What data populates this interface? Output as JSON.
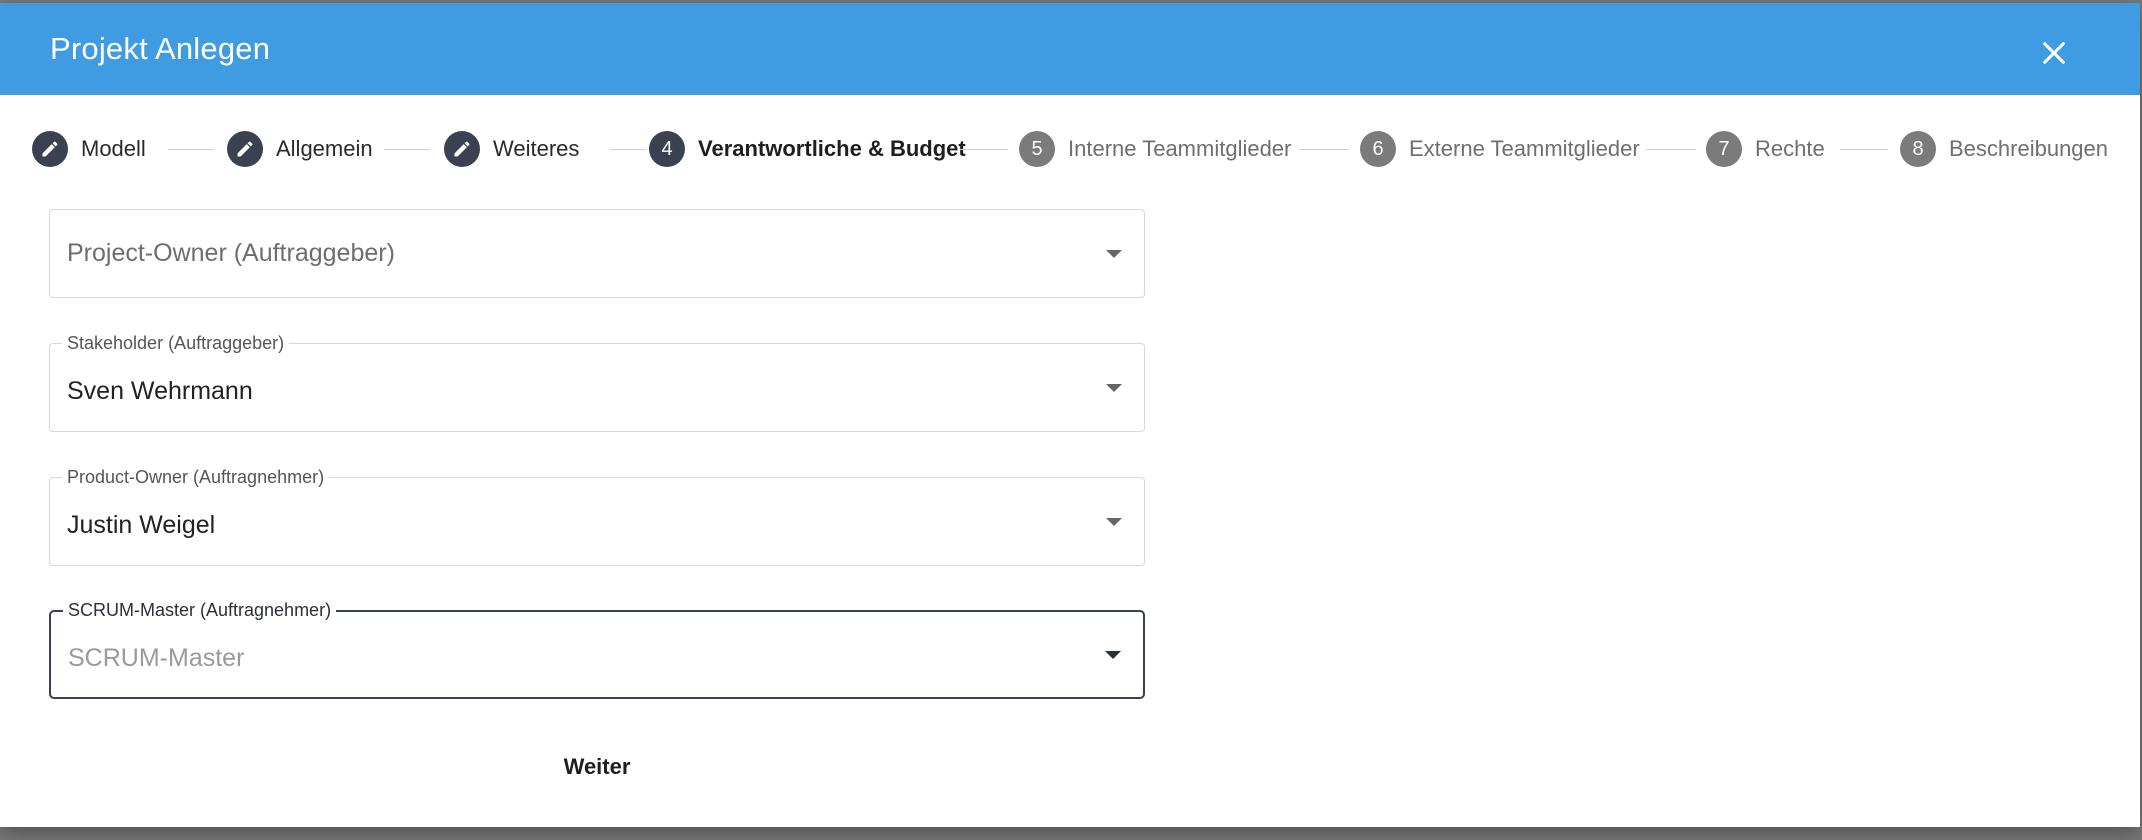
{
  "dialog": {
    "title": "Projekt Anlegen"
  },
  "icons": {
    "close": "close-icon",
    "edit": "pencil-icon",
    "dropdown": "caret-down-icon"
  },
  "colors": {
    "header": "#3f9be2",
    "step_active": "#3b4150",
    "step_pending": "#7b7b7b"
  },
  "stepper": {
    "steps": [
      {
        "label": "Modell",
        "state": "done"
      },
      {
        "label": "Allgemein",
        "state": "done"
      },
      {
        "label": "Weiteres",
        "state": "done"
      },
      {
        "label": "Verantwortliche & Budget",
        "number": "4",
        "state": "active"
      },
      {
        "label": "Interne Teammitglieder",
        "number": "5",
        "state": "pending"
      },
      {
        "label": "Externe Teammitglieder",
        "number": "6",
        "state": "pending"
      },
      {
        "label": "Rechte",
        "number": "7",
        "state": "pending"
      },
      {
        "label": "Beschreibungen",
        "number": "8",
        "state": "pending"
      }
    ]
  },
  "form": {
    "project_owner": {
      "placeholder": "Project-Owner (Auftraggeber)"
    },
    "stakeholder": {
      "label": "Stakeholder (Auftraggeber)",
      "value": "Sven Wehrmann"
    },
    "product_owner": {
      "label": "Product-Owner (Auftragnehmer)",
      "value": "Justin Weigel"
    },
    "scrum_master": {
      "label": "SCRUM-Master (Auftragnehmer)",
      "placeholder": "SCRUM-Master"
    }
  },
  "actions": {
    "next_label": "Weiter"
  }
}
